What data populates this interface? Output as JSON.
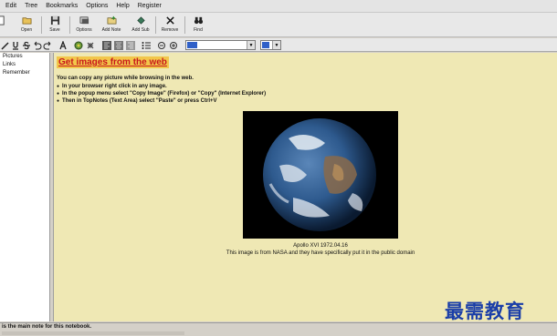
{
  "menu": [
    "Edit",
    "Tree",
    "Bookmarks",
    "Options",
    "Help",
    "Register"
  ],
  "toolbar": [
    {
      "label": "Open",
      "icon": "open-folder-icon"
    },
    {
      "label": "Save",
      "icon": "save-disk-icon"
    },
    {
      "label": "Options",
      "icon": "options-icon"
    },
    {
      "label": "Add Note",
      "icon": "add-note-icon"
    },
    {
      "label": "Add Sub",
      "icon": "add-sub-icon"
    },
    {
      "label": "Remove",
      "icon": "remove-x-icon"
    },
    {
      "label": "Find",
      "icon": "binoculars-icon"
    }
  ],
  "format_toolbar": {
    "buttons": [
      "pen-icon",
      "underline-icon",
      "strikethrough-icon",
      "undo-icon",
      "redo-icon",
      "font-a-icon",
      "picture-icon",
      "link-icon",
      "align-left-icon",
      "align-center-icon",
      "align-right-icon",
      "list-icon",
      "indent-icon",
      "outdent-icon"
    ],
    "font_combo_value": "",
    "color_combo_value": ""
  },
  "tree": {
    "items": [
      "Pictures",
      "Links",
      "Remember"
    ]
  },
  "note": {
    "title": "Get images from the web",
    "intro": "You can copy any picture while browsing in the web.",
    "bullets": [
      "In your browser right click in any image.",
      "In the popup menu select \"Copy Image\" (Firefox) or \"Copy\"  (Internet Explorer)",
      "Then in TopNotes (Text Area) select \"Paste\" or press Ctrl+V"
    ],
    "image_caption": "Apollo XVI   1972.04.16",
    "image_credit": "This image is from NASA and they have specifically put it in the public domain"
  },
  "status": {
    "text": "is the main note for this notebook."
  },
  "watermark": "最需教育",
  "colors": {
    "content_bg": "#efe8b4",
    "title_bg": "#f2c64a",
    "title_fg": "#c8181c",
    "watermark": "#1a3ea8"
  }
}
